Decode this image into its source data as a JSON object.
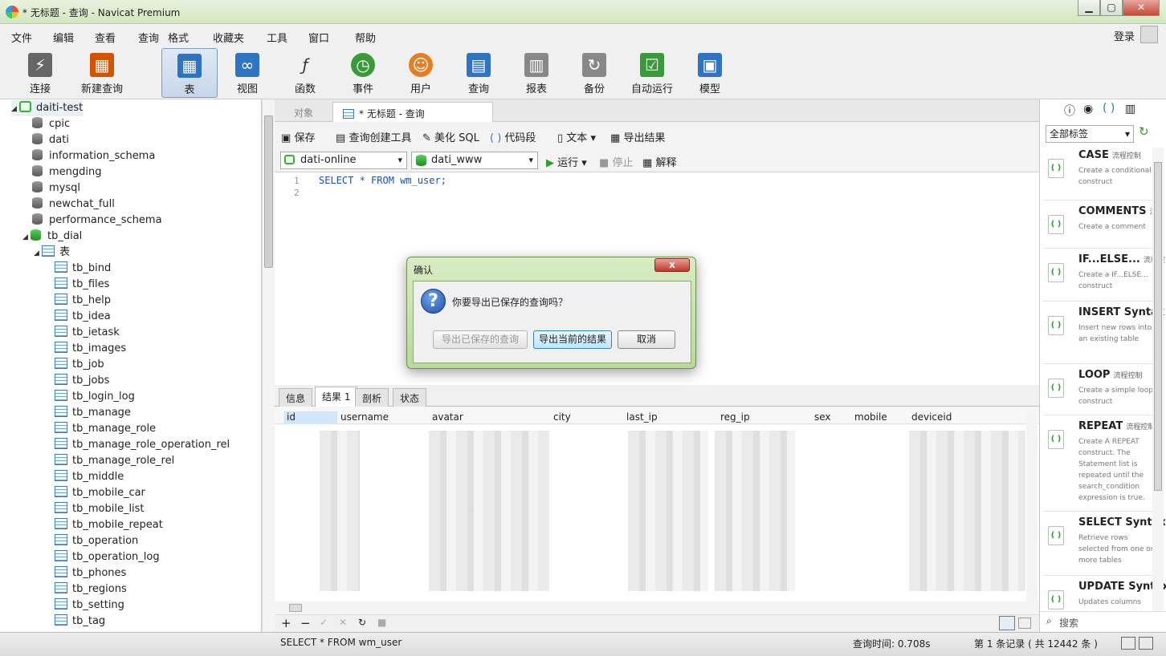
{
  "window": {
    "title": "* 无标题 - 查询 - Navicat Premium",
    "min": "▁",
    "max": "▢",
    "close": "✕"
  },
  "menu": [
    "文件",
    "编辑",
    "查看",
    "查询",
    "格式",
    "收藏夹",
    "工具",
    "窗口",
    "帮助"
  ],
  "login": "登录",
  "toolbar": [
    {
      "label": "连接",
      "icon": "plug-icon",
      "color": "#555"
    },
    {
      "label": "新建查询",
      "icon": "new-query-icon",
      "color": "#d35400"
    },
    {
      "label": "表",
      "icon": "table-icon",
      "color": "#2f74c0"
    },
    {
      "label": "视图",
      "icon": "view-icon",
      "color": "#2f74c0"
    },
    {
      "label": "函数",
      "icon": "function-icon",
      "color": "#444"
    },
    {
      "label": "事件",
      "icon": "clock-icon",
      "color": "#3a9a3a"
    },
    {
      "label": "用户",
      "icon": "user-icon",
      "color": "#e67e22"
    },
    {
      "label": "查询",
      "icon": "query-icon",
      "color": "#2f74c0"
    },
    {
      "label": "报表",
      "icon": "report-icon",
      "color": "#777"
    },
    {
      "label": "备份",
      "icon": "backup-icon",
      "color": "#777"
    },
    {
      "label": "自动运行",
      "icon": "schedule-icon",
      "color": "#3a9a3a"
    },
    {
      "label": "模型",
      "icon": "model-icon",
      "color": "#2f74c0"
    }
  ],
  "tree": {
    "connection": "daiti-test",
    "databases": [
      "cpic",
      "dati",
      "information_schema",
      "mengding",
      "mysql",
      "newchat_full",
      "performance_schema"
    ],
    "open_db": "tb_dial",
    "tables_label": "表",
    "tables": [
      "tb_bind",
      "tb_files",
      "tb_help",
      "tb_idea",
      "tb_ietask",
      "tb_images",
      "tb_job",
      "tb_jobs",
      "tb_login_log",
      "tb_manage",
      "tb_manage_role",
      "tb_manage_role_operation_rel",
      "tb_manage_role_rel",
      "tb_middle",
      "tb_mobile_car",
      "tb_mobile_list",
      "tb_mobile_repeat",
      "tb_operation",
      "tb_operation_log",
      "tb_phones",
      "tb_regions",
      "tb_setting",
      "tb_tag"
    ]
  },
  "tabs": {
    "objects": "对象",
    "query": "* 无标题 - 查询"
  },
  "qtool": {
    "save": "保存",
    "builder": "查询创建工具",
    "beautify": "美化 SQL",
    "snippet": "代码段",
    "text": "文本",
    "export": "导出结果"
  },
  "qsel": {
    "connection": "dati-online",
    "database": "dati_www",
    "run": "运行",
    "stop": "停止",
    "explain": "解释"
  },
  "editor": {
    "lines": [
      "1",
      "2"
    ],
    "code": "SELECT * FROM wm_user;"
  },
  "result_tabs": [
    "信息",
    "结果 1",
    "剖析",
    "状态"
  ],
  "columns": [
    "id",
    "username",
    "avatar",
    "city",
    "last_ip",
    "reg_ip",
    "sex",
    "mobile",
    "deviceid"
  ],
  "rpanel": {
    "filter": "全部标签",
    "search": "搜索"
  },
  "snippets": [
    {
      "title": "CASE",
      "tag": "流程控制",
      "desc": "Create a conditional construct"
    },
    {
      "title": "COMMENTS",
      "tag": "注",
      "desc": "Create a comment"
    },
    {
      "title": "IF...ELSE...",
      "tag": "流程控",
      "desc": "Create a IF...ELSE... construct"
    },
    {
      "title": "INSERT Syntax",
      "tag": "",
      "desc": "Insert new rows into an existing table"
    },
    {
      "title": "LOOP",
      "tag": "流程控制",
      "desc": "Create a simple loop construct"
    },
    {
      "title": "REPEAT",
      "tag": "流程控制",
      "desc": "Create A REPEAT construct. The Statement list is repeated until the search_condition expression is true."
    },
    {
      "title": "SELECT Syntax",
      "tag": "",
      "desc": "Retrieve rows selected from one or more tables"
    },
    {
      "title": "UPDATE Syntax",
      "tag": "",
      "desc": "Updates columns"
    }
  ],
  "status": {
    "sql": "SELECT * FROM wm_user",
    "time": "查询时间: 0.708s",
    "records": "第 1 条记录 ( 共 12442 条 )"
  },
  "dialog": {
    "title": "确认",
    "message": "你要导出已保存的查询吗？",
    "btn_saved": "导出已保存的查询",
    "btn_current": "导出当前的结果",
    "btn_cancel": "取消",
    "close": "x"
  }
}
